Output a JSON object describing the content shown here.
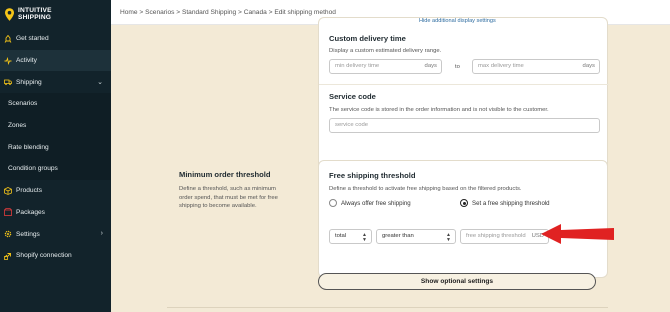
{
  "app": {
    "logo_line1": "INTUITIVE",
    "logo_line2": "SHIPPING"
  },
  "sidebar": {
    "items": [
      {
        "label": "Get started",
        "icon": "rocket-icon"
      },
      {
        "label": "Activity",
        "icon": "activity-icon"
      },
      {
        "label": "Shipping",
        "icon": "truck-icon"
      },
      {
        "label": "Scenarios"
      },
      {
        "label": "Zones"
      },
      {
        "label": "Rate blending"
      },
      {
        "label": "Condition groups"
      },
      {
        "label": "Products",
        "icon": "box-icon"
      },
      {
        "label": "Packages",
        "icon": "package-icon"
      },
      {
        "label": "Settings",
        "icon": "gear-icon"
      },
      {
        "label": "Shopify connection",
        "icon": "link-icon"
      }
    ]
  },
  "header": {
    "breadcrumb": "Home > Scenarios > Standard Shipping > Canada > Edit shipping method"
  },
  "delivery": {
    "hide_link": "Hide additional display settings",
    "title": "Custom delivery time",
    "desc": "Display a custom estimated delivery range.",
    "min_placeholder": "min delivery time",
    "max_placeholder": "max delivery time",
    "suffix": "days",
    "to": "to"
  },
  "service": {
    "title": "Service code",
    "desc": "The service code is stored in the order information and is not visible to the customer.",
    "placeholder": "service code"
  },
  "threshold": {
    "left_title": "Minimum order threshold",
    "left_desc": "Define a threshold, such as minimum order spend, that must be met for free shipping to become available.",
    "title": "Free shipping threshold",
    "desc": "Define a threshold to activate free shipping based on the filtered products.",
    "radio_always": "Always offer free shipping",
    "radio_set": "Set a free shipping threshold",
    "select_total": "total",
    "select_compare": "greater than",
    "input_placeholder": "free shipping threshold",
    "input_suffix": "USD"
  },
  "actions": {
    "optional_settings": "Show optional settings"
  },
  "colors": {
    "sidebar_bg": "#12232b",
    "page_bg": "#f3ead6",
    "accent_yellow": "#f5c518",
    "arrow_red": "#e02222"
  }
}
